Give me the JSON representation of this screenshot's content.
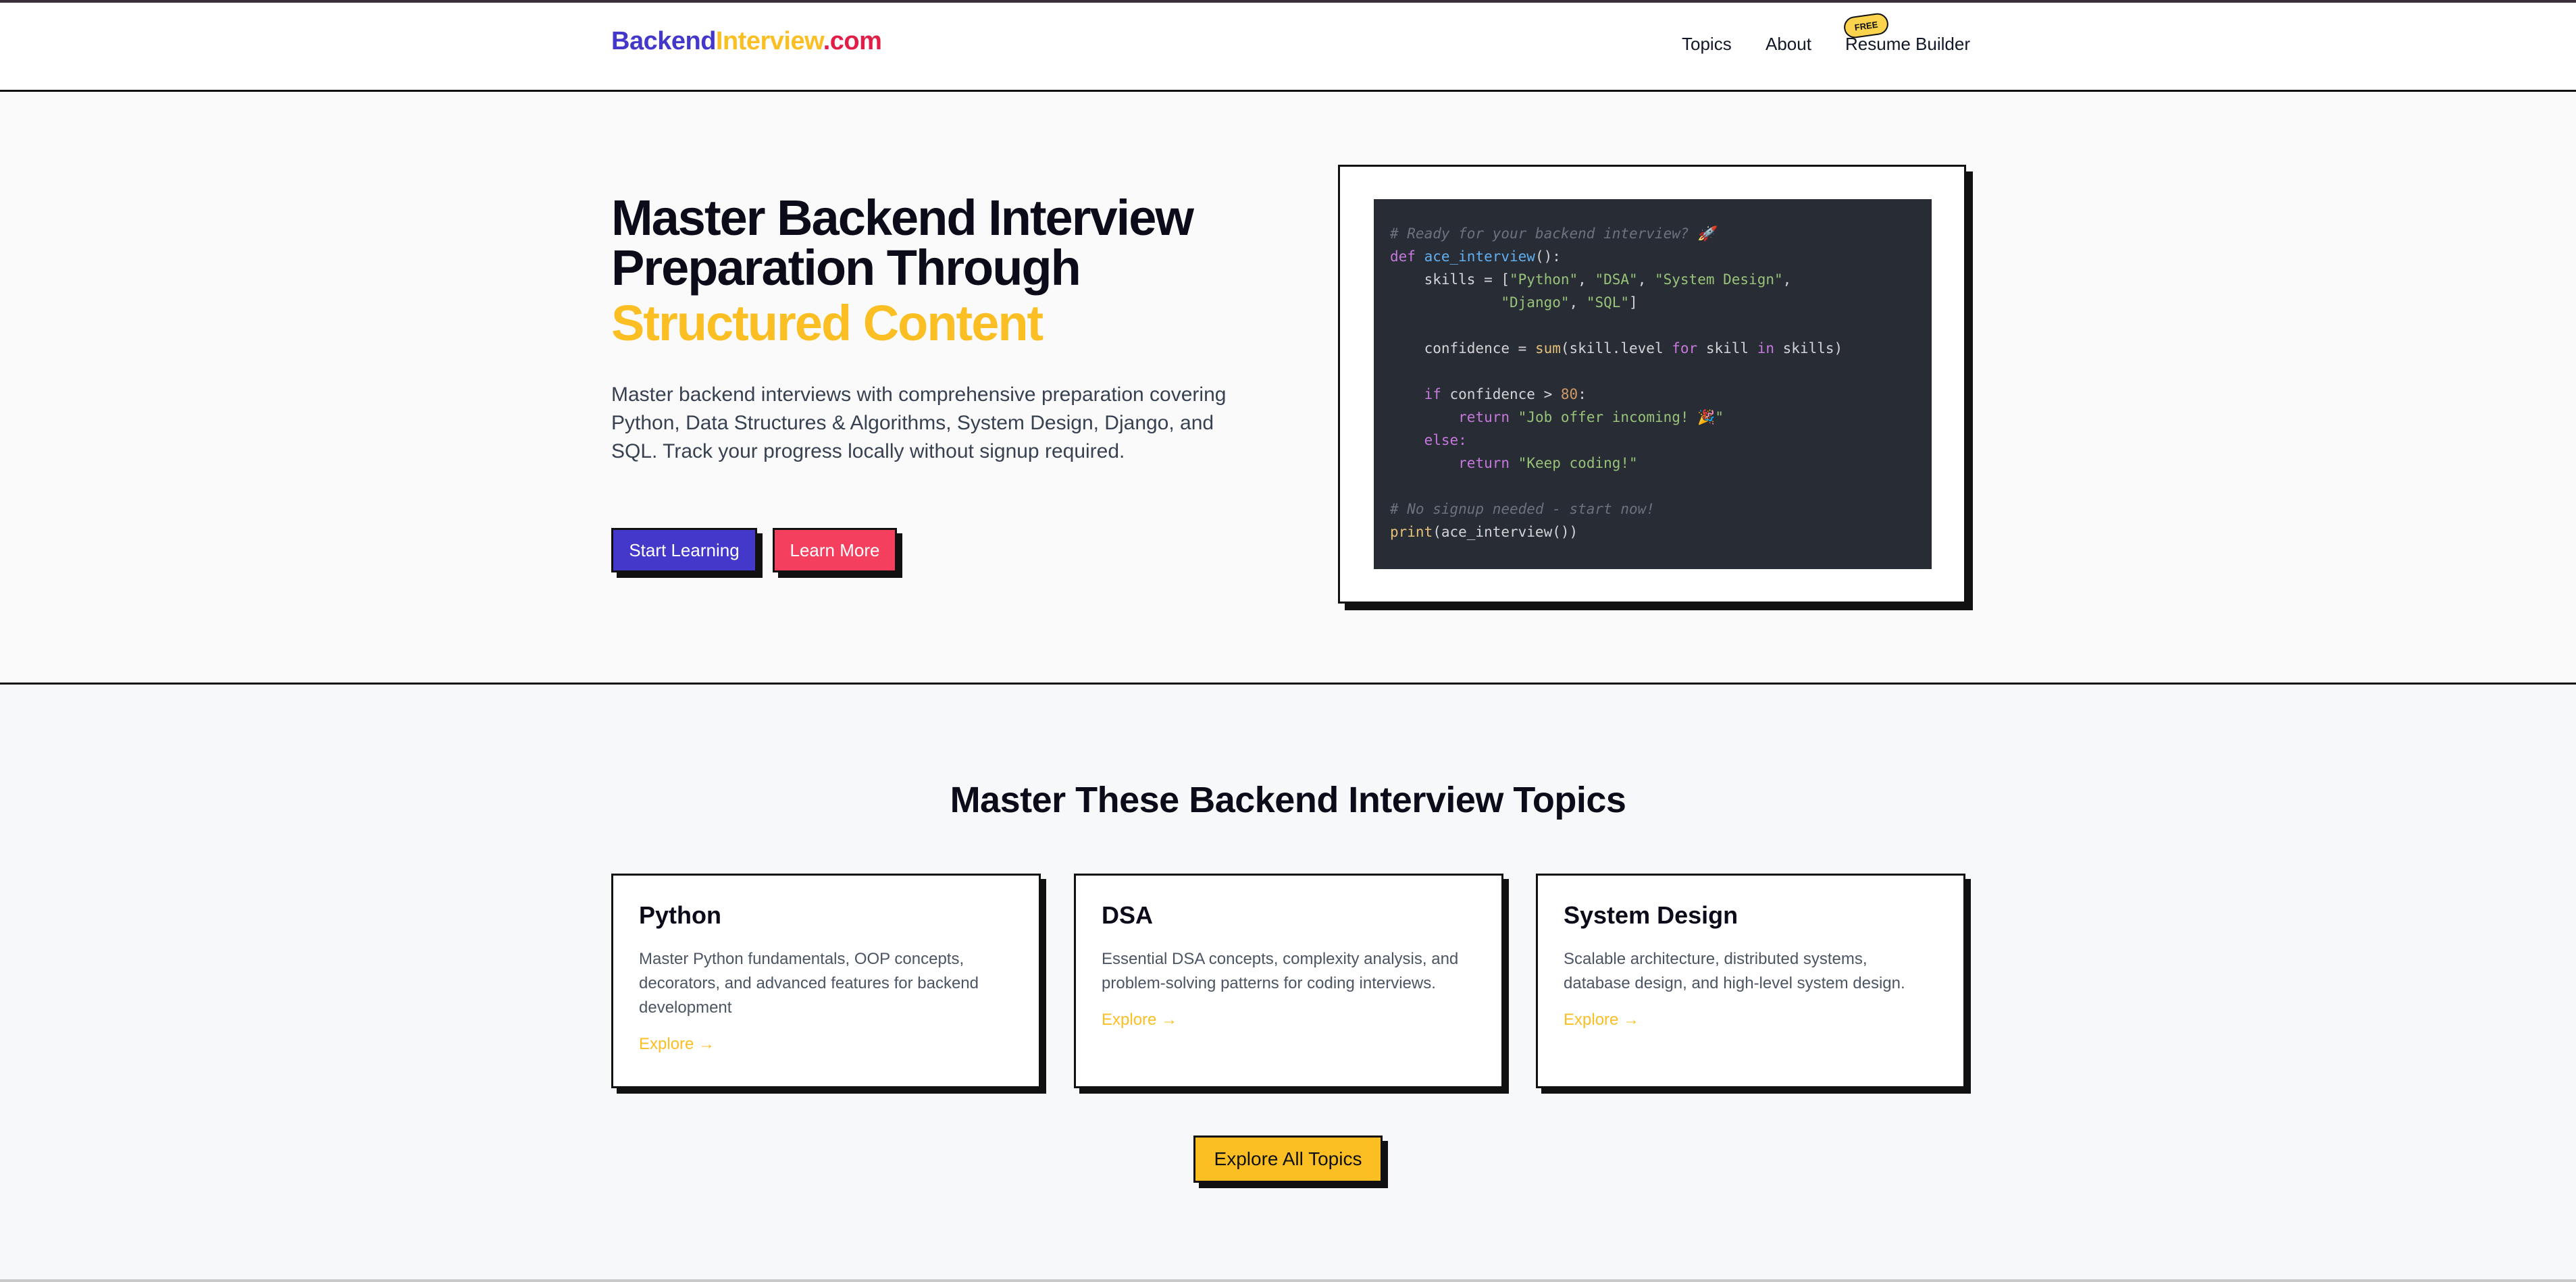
{
  "header": {
    "logo": {
      "part1": "Backend",
      "part2": "Interview",
      "part3": ".com"
    },
    "nav": {
      "topics": "Topics",
      "about": "About",
      "resume": "Resume Builder",
      "free_badge": "FREE"
    }
  },
  "hero": {
    "title_line1": "Master Backend Interview",
    "title_line2": "Preparation Through",
    "title_highlight": "Structured Content",
    "description": "Master backend interviews with comprehensive preparation covering Python, Data Structures & Algorithms, System Design, Django, and SQL. Track your progress locally without signup required.",
    "start_button": "Start Learning",
    "learn_button": "Learn More",
    "code": {
      "comment1": "# Ready for your backend interview? 🚀",
      "def": "def",
      "fn_name": "ace_interview",
      "params": "():",
      "skills_lhs": "    skills = [",
      "s_python": "\"Python\"",
      "s_dsa": "\"DSA\"",
      "s_sd": "\"System Design\"",
      "s_django": "\"Django\"",
      "s_sql": "\"SQL\"",
      "conf_lhs": "    confidence = ",
      "sum": "sum",
      "conf_rest": "(skill.level ",
      "for": "for",
      "mid": " skill ",
      "in": "in",
      "conf_end": " skills)",
      "if": "if",
      "if_rest": " confidence > ",
      "num": "80",
      "return": "return",
      "ret1": "\"Job offer incoming! 🎉\"",
      "else": "else:",
      "ret2": "\"Keep coding!\"",
      "comment2": "# No signup needed - start now!",
      "print": "print",
      "print_rest": "(ace_interview())"
    }
  },
  "topics": {
    "title": "Master These Backend Interview Topics",
    "cards": [
      {
        "title": "Python",
        "description": "Master Python fundamentals, OOP concepts, decorators, and advanced features for backend development",
        "link": "Explore →"
      },
      {
        "title": "DSA",
        "description": "Essential DSA concepts, complexity analysis, and problem-solving patterns for coding interviews.",
        "link": "Explore →"
      },
      {
        "title": "System Design",
        "description": "Scalable architecture, distributed systems, database design, and high-level system design.",
        "link": "Explore →"
      }
    ],
    "explore_all": "Explore All Topics"
  }
}
